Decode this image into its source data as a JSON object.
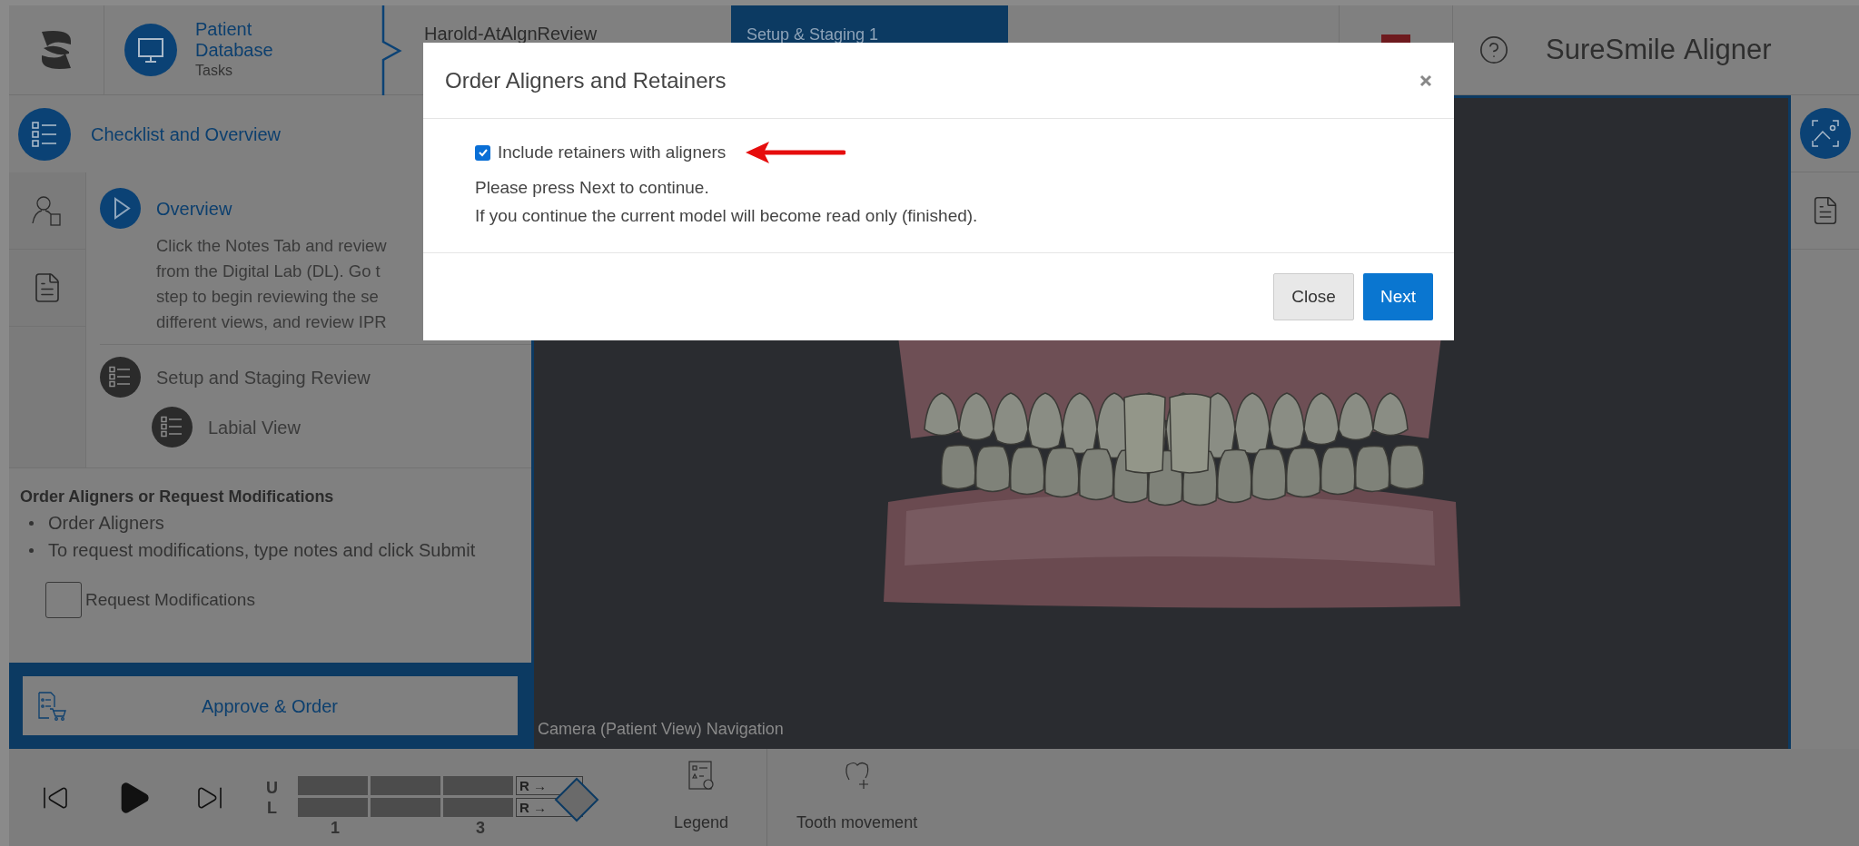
{
  "header": {
    "breadcrumb": [
      {
        "title": "Patient Database",
        "subtitle": "Tasks"
      },
      {
        "title": "Harold-AtAlgnReview"
      }
    ],
    "stage_tab": {
      "label": "Setup & Staging 1",
      "selected": true
    },
    "app_title": {
      "brand": "SureSmile",
      "product": "Aligner"
    }
  },
  "checklist": {
    "title": "Checklist and Overview",
    "items": [
      {
        "kind": "overview",
        "title": "Overview",
        "lines": [
          "Click the Notes Tab and review",
          "from the Digital Lab (DL). Go t",
          "step to begin reviewing the se",
          "different views, and review IPR"
        ]
      },
      {
        "kind": "list",
        "title": "Setup and Staging Review",
        "children": [
          {
            "kind": "list",
            "title": "Labial View"
          }
        ]
      }
    ]
  },
  "order_section": {
    "title": "Order Aligners or Request Modifications",
    "bullets": [
      "Order Aligners",
      "To request modifications, type notes and click Submit"
    ],
    "request_modifications": {
      "label": "Request Modifications",
      "checked": false
    }
  },
  "approve_button": {
    "label": "Approve & Order"
  },
  "viewport": {
    "caption": "Camera (Patient View) Navigation"
  },
  "timeline": {
    "arch_labels": [
      "U",
      "L"
    ],
    "markers": [
      "R →",
      "R →"
    ],
    "stage_numbers": [
      "1",
      "3"
    ]
  },
  "toolbar": [
    {
      "kind": "legend",
      "label": "Legend"
    },
    {
      "kind": "tooth",
      "label": "Tooth movement"
    }
  ],
  "dialog": {
    "title": "Order Aligners and Retainers",
    "include_retainers": {
      "label": "Include retainers with aligners",
      "checked": true
    },
    "messages": [
      "Please press Next to continue.",
      "If you continue the current model will become read only (finished)."
    ],
    "buttons": [
      {
        "label": "Close",
        "kind": "secondary"
      },
      {
        "label": "Next",
        "kind": "primary"
      }
    ]
  }
}
